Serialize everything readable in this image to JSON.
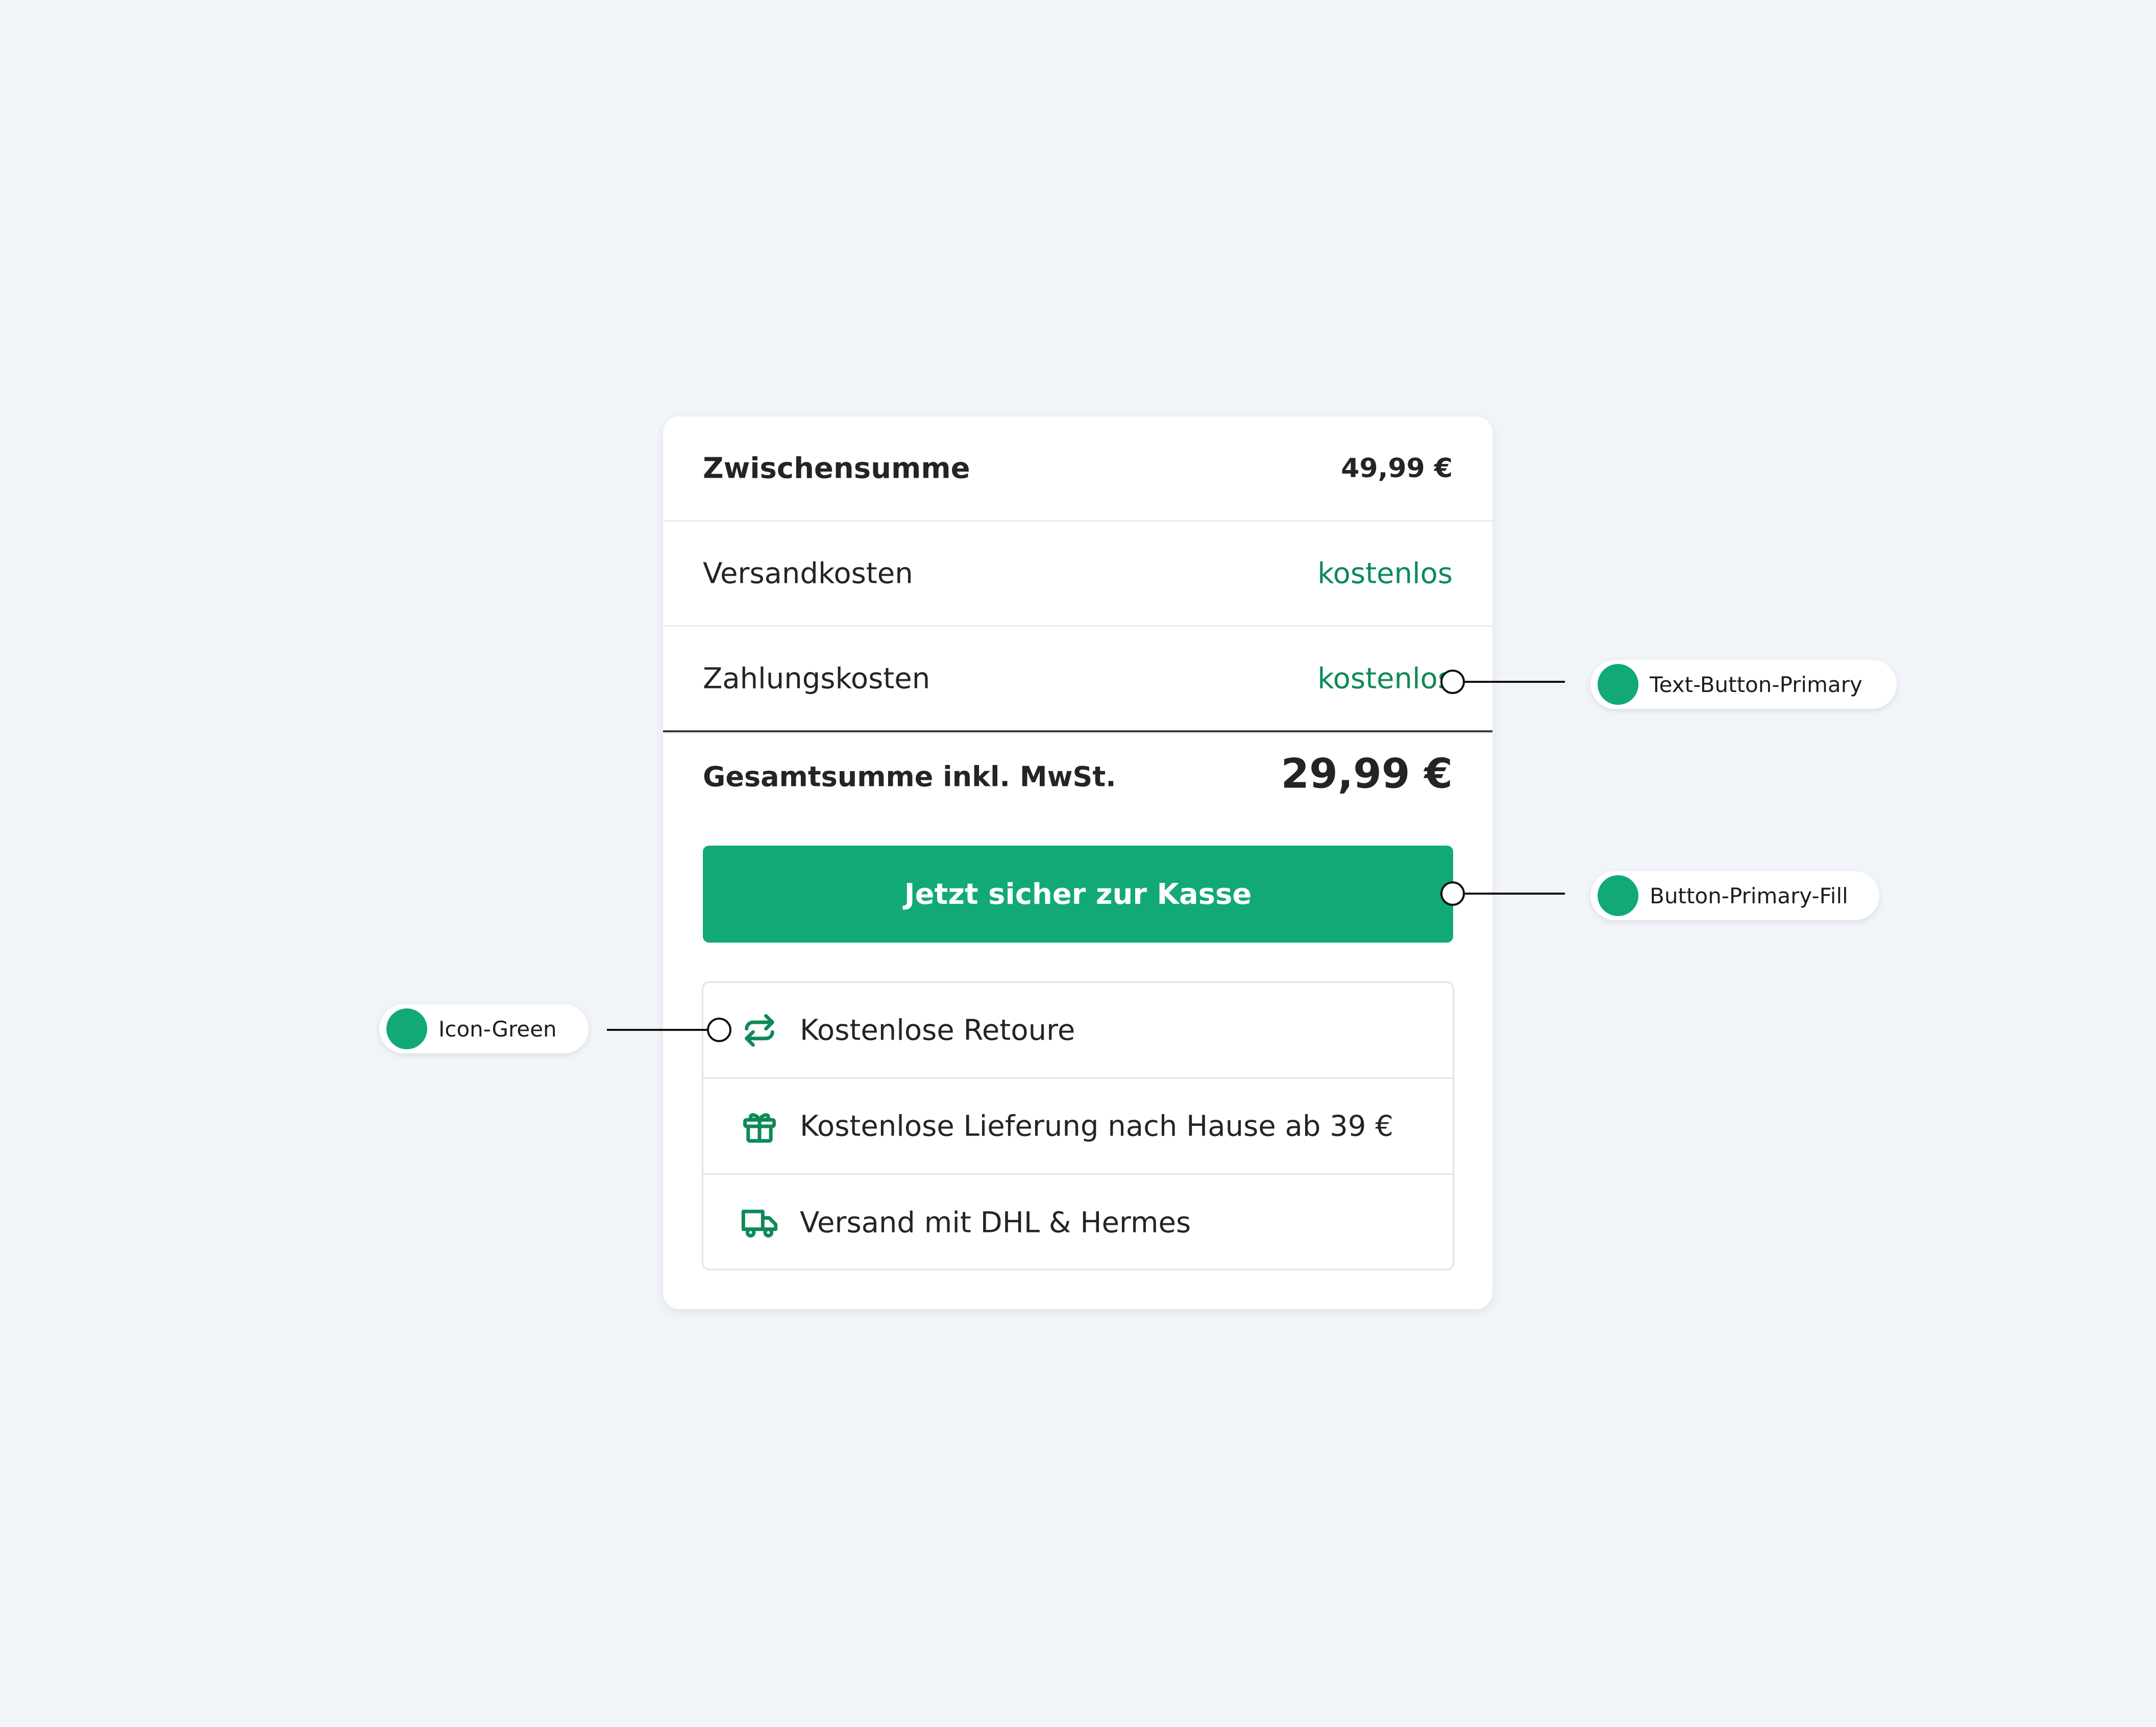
{
  "summary": {
    "subtotal_label": "Zwischensumme",
    "subtotal_value": "49,99 €",
    "shipping_label": "Versandkosten",
    "shipping_value": "kostenlos",
    "payment_label": "Zahlungskosten",
    "payment_value": "kostenlos",
    "total_label": "Gesamtsumme inkl. MwSt.",
    "total_value": "29,99 €"
  },
  "cta": {
    "label": "Jetzt sicher zur Kasse"
  },
  "benefits": [
    {
      "icon": "return-arrows-icon",
      "label": "Kostenlose Retoure"
    },
    {
      "icon": "gift-icon",
      "label": "Kostenlose Lieferung nach Hause ab 39 €"
    },
    {
      "icon": "truck-icon",
      "label": "Versand mit DHL & Hermes"
    }
  ],
  "annotations": {
    "text_button_primary": "Text-Button-Primary",
    "button_primary_fill": "Button-Primary-Fill",
    "icon_green": "Icon-Green"
  },
  "colors": {
    "background": "#f1f4f8",
    "card": "#ffffff",
    "primary_fill": "#12a979",
    "primary_text": "#0d8a57",
    "icon_green": "#0d8a57",
    "text": "#242424"
  }
}
